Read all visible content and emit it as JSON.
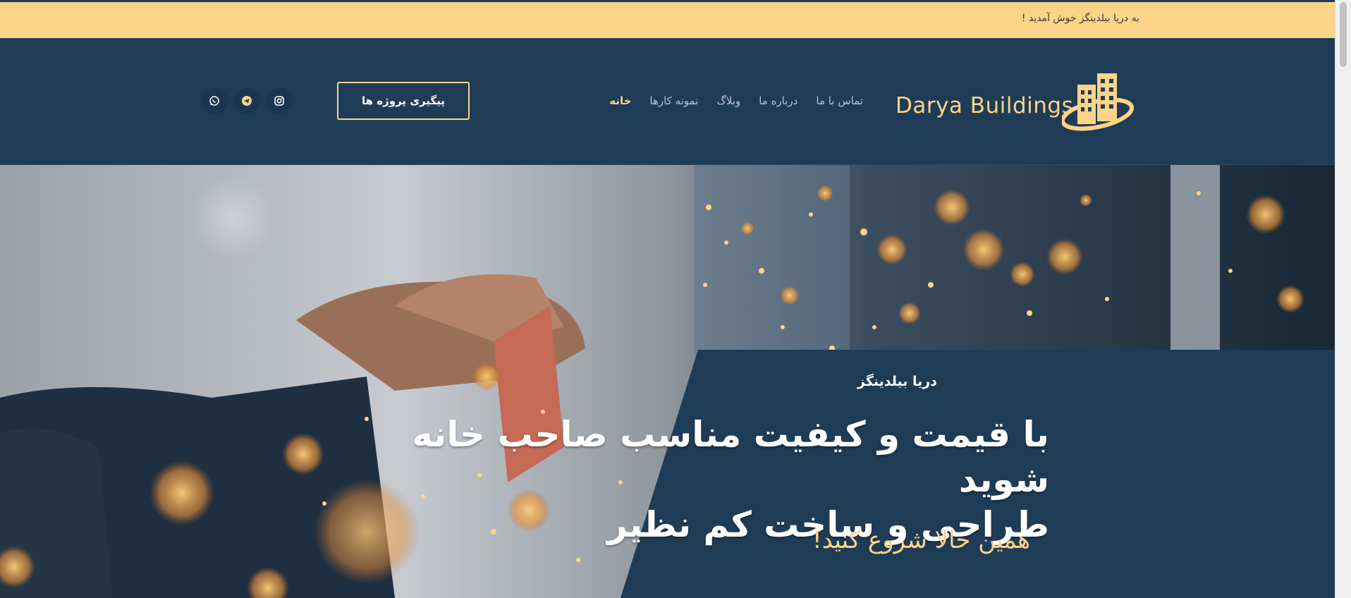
{
  "announcement": {
    "text": "به دریا بیلدینگز خوش آمدید !"
  },
  "brand": {
    "name": "Darya Buildings"
  },
  "nav": {
    "items": [
      {
        "label": "خانه",
        "active": true
      },
      {
        "label": "نمونه کارها",
        "active": false
      },
      {
        "label": "وبلاگ",
        "active": false
      },
      {
        "label": "درباره ما",
        "active": false
      },
      {
        "label": "تماس با ما",
        "active": false
      }
    ]
  },
  "header": {
    "track_button_label": "پیگیری پروژه ها"
  },
  "social": [
    "instagram-icon",
    "telegram-icon",
    "whatsapp-icon"
  ],
  "hero": {
    "subtitle": "دریا بیلدینگز",
    "title_line1": "با قیمت و کیفیت مناسب صاحب خانه شوید",
    "title_line2": "طراحی و ساخت کم نظیر",
    "cta": "همین حالا شروع کنید!"
  },
  "colors": {
    "accent": "#fdd388",
    "navy": "#1f3c57",
    "white": "#ffffff"
  }
}
